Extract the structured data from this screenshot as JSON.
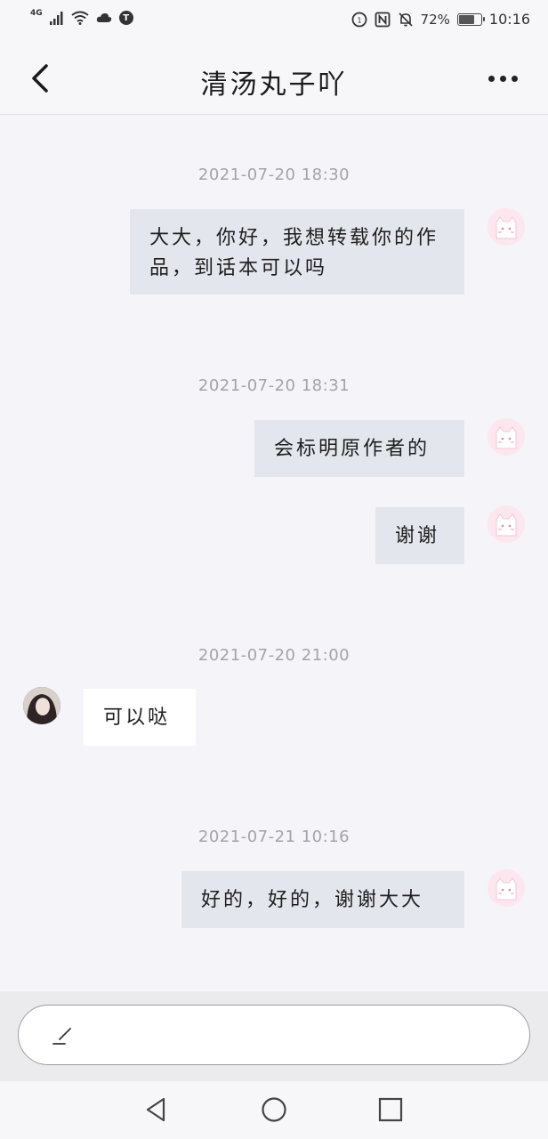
{
  "status_bar": {
    "network": "4G",
    "battery_percent": "72%",
    "battery_level": 0.72,
    "time": "10:16",
    "t_badge": "T"
  },
  "header": {
    "title": "清汤丸子吖",
    "back_icon": "chevron-left-icon",
    "more_icon": "more-horizontal-icon"
  },
  "messages": [
    {
      "type": "timestamp",
      "text": "2021-07-20 18:30"
    },
    {
      "type": "message",
      "from": "me",
      "text": "大大，你好，我想转载你的作品，到话本可以吗"
    },
    {
      "type": "timestamp",
      "text": "2021-07-20 18:31"
    },
    {
      "type": "message",
      "from": "me",
      "text": "会标明原作者的"
    },
    {
      "type": "message",
      "from": "me",
      "text": "谢谢"
    },
    {
      "type": "timestamp",
      "text": "2021-07-20 21:00"
    },
    {
      "type": "message",
      "from": "them",
      "text": "可以哒"
    },
    {
      "type": "timestamp",
      "text": "2021-07-21 10:16"
    },
    {
      "type": "message",
      "from": "me",
      "text": "好的，好的，谢谢大大"
    }
  ],
  "composer": {
    "icon": "pen-icon",
    "value": ""
  },
  "nav": {
    "back_icon": "triangle-back-icon",
    "home_icon": "circle-home-icon",
    "recents_icon": "square-recents-icon"
  },
  "colors": {
    "background": "#f5f4f9",
    "my_bubble": "#e4e6ed",
    "their_bubble": "#ffffff",
    "timestamp": "#a3a3a8"
  }
}
